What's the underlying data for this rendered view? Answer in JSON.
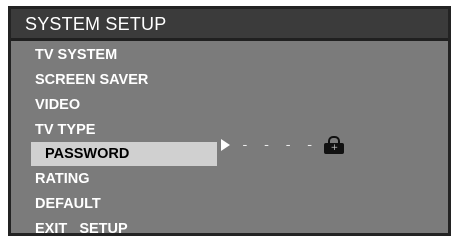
{
  "title": "SYSTEM SETUP",
  "menu": {
    "items": [
      {
        "label": "TV SYSTEM"
      },
      {
        "label": "SCREEN SAVER"
      },
      {
        "label": "VIDEO"
      },
      {
        "label": "TV TYPE"
      },
      {
        "label": "PASSWORD"
      },
      {
        "label": "RATING"
      },
      {
        "label": "DEFAULT"
      },
      {
        "label": "EXIT   SETUP"
      }
    ],
    "selected_index": 4
  },
  "password": {
    "value": "- - - -",
    "pointer_icon": "triangle-right-icon",
    "lock_icon": "lock-icon"
  }
}
